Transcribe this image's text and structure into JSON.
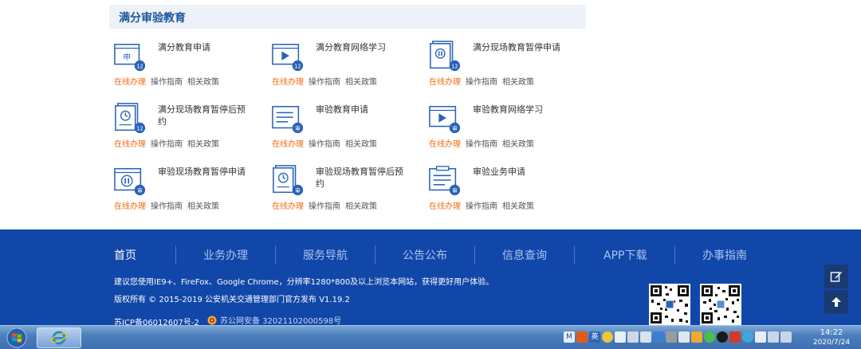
{
  "section": {
    "title": "满分审验教育"
  },
  "items": [
    {
      "name": "满分教育申请",
      "icon": "apply-doc-icon",
      "badge": "12"
    },
    {
      "name": "满分教育网络学习",
      "icon": "video-play-icon",
      "badge": "12"
    },
    {
      "name": "满分现场教育暂停申请",
      "icon": "pause-doc-icon",
      "badge": "12"
    },
    {
      "name": "满分现场教育暂停后预约",
      "icon": "clock-doc-icon",
      "badge": "12"
    },
    {
      "name": "审验教育申请",
      "icon": "lines-doc-icon",
      "badge": "审"
    },
    {
      "name": "审验教育网络学习",
      "icon": "video-play-icon",
      "badge": "审"
    },
    {
      "name": "审验现场教育暂停申请",
      "icon": "pause-window-icon",
      "badge": "审"
    },
    {
      "name": "审验现场教育暂停后预约",
      "icon": "clock-doc-icon",
      "badge": "审"
    },
    {
      "name": "审验业务申请",
      "icon": "form-doc-icon",
      "badge": "审"
    }
  ],
  "links": {
    "online": "在线办理",
    "guide": "操作指南",
    "policy": "相关政策"
  },
  "footer": {
    "nav": [
      "首页",
      "业务办理",
      "服务导航",
      "公告公布",
      "信息查询",
      "APP下载",
      "办事指南"
    ],
    "browser_tip": "建议您使用IE9+、FireFox、Google Chrome，分辨率1280*800及以上浏览本网站，获得更好用户体验。",
    "copyright": "版权所有 © 2015-2019 公安机关交通管理部门官方发布 V1.19.2",
    "icp": "苏ICP备06012607号-2",
    "police_record": "苏公网安备 32021102000598号"
  },
  "taskbar": {
    "time": "14:22",
    "date": "2020/7/24",
    "ime": "英"
  },
  "colors": {
    "accent": "#1e56a0",
    "footer": "#1147a8",
    "online": "#f26a10"
  }
}
